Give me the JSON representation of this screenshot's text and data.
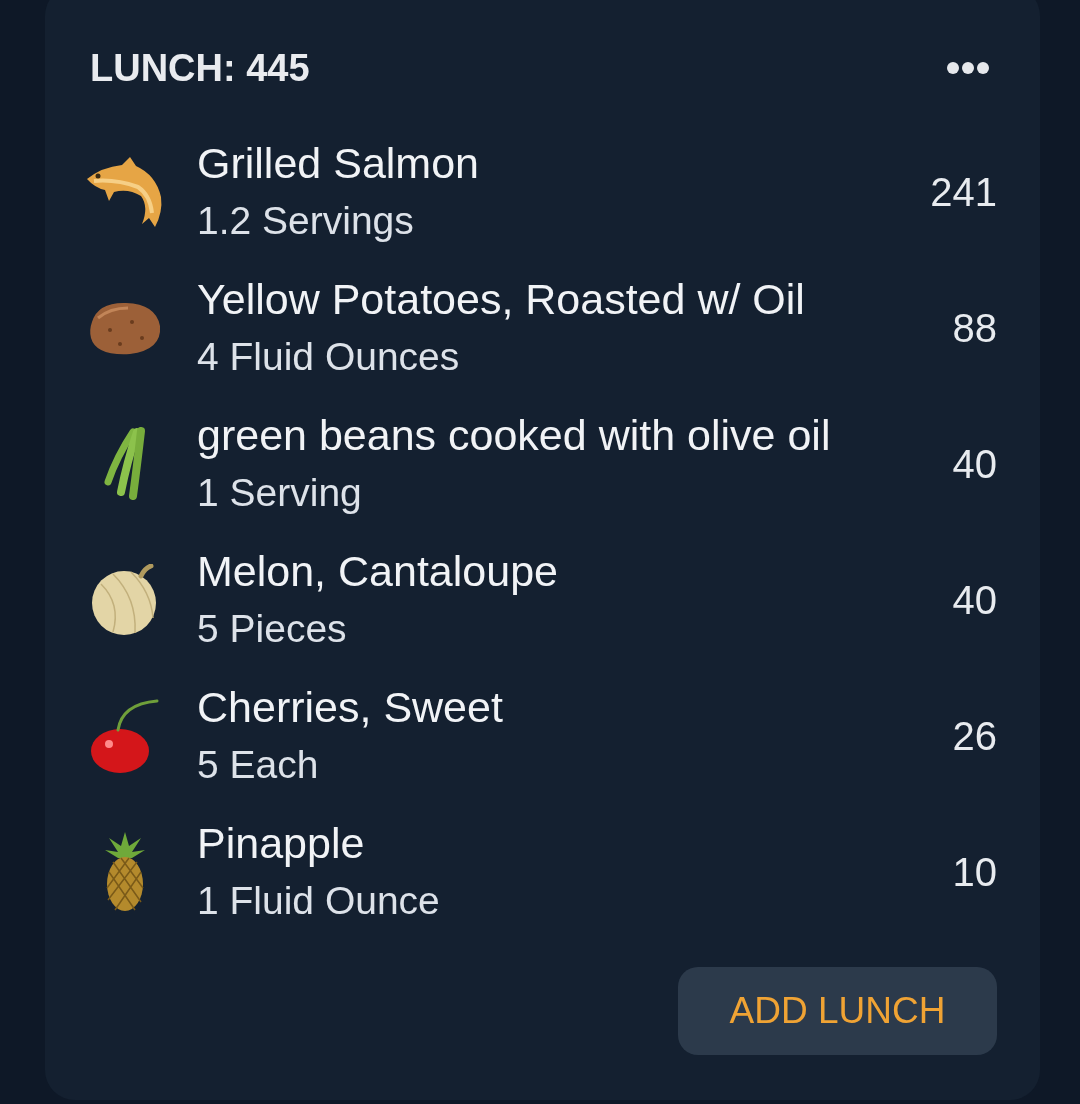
{
  "meal": {
    "title": "LUNCH: 445"
  },
  "items": [
    {
      "kind": "fish",
      "name": "Grilled Salmon",
      "serving": "1.2 Servings",
      "calories": "241"
    },
    {
      "kind": "potato",
      "name": "Yellow Potatoes, Roasted w/ Oil",
      "serving": "4 Fluid Ounces",
      "calories": "88"
    },
    {
      "kind": "beans",
      "name": "green beans cooked with olive oil",
      "serving": "1 Serving",
      "calories": "40"
    },
    {
      "kind": "melon",
      "name": "Melon, Cantaloupe",
      "serving": "5 Pieces",
      "calories": "40"
    },
    {
      "kind": "cherry",
      "name": "Cherries, Sweet",
      "serving": "5 Each",
      "calories": "26"
    },
    {
      "kind": "pineapple",
      "name": "Pinapple",
      "serving": "1 Fluid Ounce",
      "calories": "10"
    }
  ],
  "add_button": "ADD LUNCH"
}
